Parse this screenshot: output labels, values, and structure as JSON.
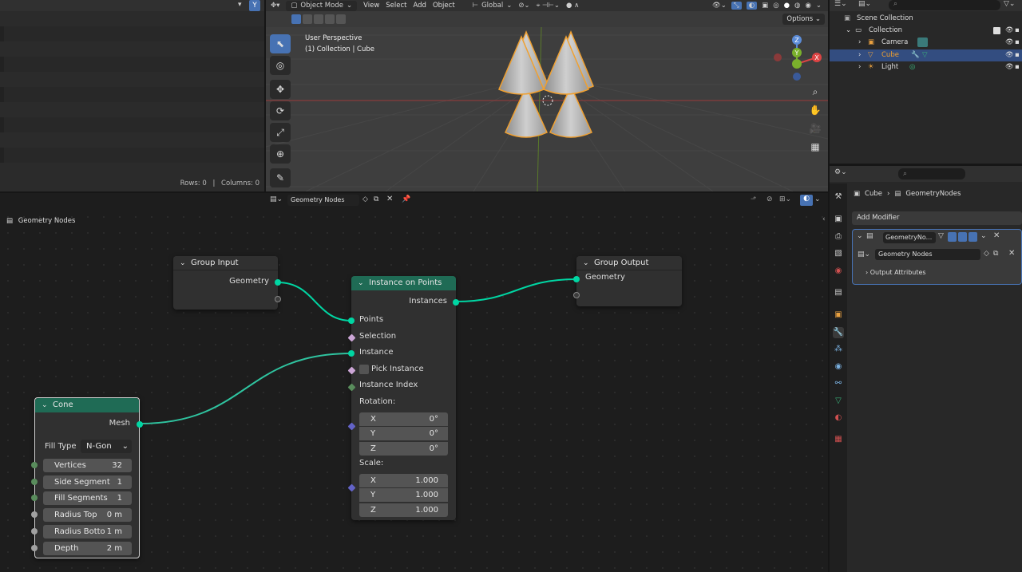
{
  "spreadsheet": {
    "rows_label": "Rows: 0",
    "sep": "|",
    "columns_label": "Columns: 0"
  },
  "viewport": {
    "menu": [
      "Object Mode",
      "View",
      "Select",
      "Add",
      "Object"
    ],
    "transform_orientation": "Global",
    "options_label": "Options",
    "info_line1": "User Perspective",
    "info_line2": "(1) Collection | Cube",
    "gizmo": {
      "x": "X",
      "y": "Y",
      "z": "Z"
    }
  },
  "outliner": {
    "items": [
      {
        "label": "Scene Collection"
      },
      {
        "label": "Collection"
      },
      {
        "label": "Camera"
      },
      {
        "label": "Cube"
      },
      {
        "label": "Light"
      }
    ]
  },
  "properties": {
    "breadcrumb_object": "Cube",
    "breadcrumb_modifier": "GeometryNodes",
    "add_modifier": "Add Modifier",
    "modifier_name": "GeometryNo...",
    "node_group": "Geometry Nodes",
    "output_attributes": "Output Attributes"
  },
  "node_editor": {
    "node_tree_name": "Geometry Nodes",
    "breadcrumb": "Geometry Nodes",
    "nodes": {
      "group_input": {
        "title": "Group Input",
        "output": "Geometry"
      },
      "group_output": {
        "title": "Group Output",
        "input": "Geometry"
      },
      "instance_on_points": {
        "title": "Instance on Points",
        "output": "Instances",
        "inputs": [
          "Points",
          "Selection",
          "Instance",
          "Pick Instance",
          "Instance Index"
        ],
        "rotation_label": "Rotation:",
        "rotation": [
          {
            "axis": "X",
            "value": "0°"
          },
          {
            "axis": "Y",
            "value": "0°"
          },
          {
            "axis": "Z",
            "value": "0°"
          }
        ],
        "scale_label": "Scale:",
        "scale": [
          {
            "axis": "X",
            "value": "1.000"
          },
          {
            "axis": "Y",
            "value": "1.000"
          },
          {
            "axis": "Z",
            "value": "1.000"
          }
        ]
      },
      "cone": {
        "title": "Cone",
        "output": "Mesh",
        "fill_type_label": "Fill Type",
        "fill_type_value": "N-Gon",
        "fields": [
          {
            "name": "Vertices",
            "value": "32"
          },
          {
            "name": "Side Segment",
            "value": "1"
          },
          {
            "name": "Fill Segments",
            "value": "1"
          },
          {
            "name": "Radius Top",
            "value": "0 m"
          },
          {
            "name": "Radius Botto",
            "value": "1 m"
          },
          {
            "name": "Depth",
            "value": "2 m"
          }
        ]
      }
    }
  },
  "colors": {
    "accent": "#4772b3",
    "geometry_socket": "#00d6a3",
    "node_header_green": "#1f6b55",
    "selection_orange": "#f0a030"
  }
}
